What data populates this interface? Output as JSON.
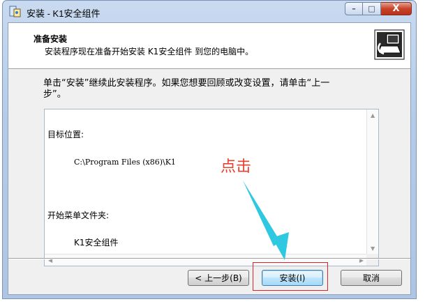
{
  "window": {
    "title": "安装 - K1安全组件",
    "caption_buttons": {
      "minimize": "–",
      "maximize": "□",
      "close": "X"
    }
  },
  "header": {
    "title": "准备安装",
    "subtitle": "安装程序现在准备开始安装 K1安全组件 到您的电脑中。",
    "icon": "installer-computer-icon"
  },
  "body": {
    "description_line1": "单击“安装”继续此安装程序。如果您想要回顾或改变设置，请单击“上一",
    "description_line2": "步”。"
  },
  "memo": {
    "dest_label": "目标位置:",
    "dest_value": "C:\\Program Files (x86)\\K1",
    "menu_label": "开始菜单文件夹:",
    "menu_value": "K1安全组件"
  },
  "buttons": {
    "back": "< 上一步(B)",
    "install": "安装(I)",
    "cancel": "取消"
  },
  "annotation": {
    "text": "点击",
    "color": "#e8402e",
    "arrow_color": "#2ec9e0",
    "box_color": "#e0202a"
  }
}
